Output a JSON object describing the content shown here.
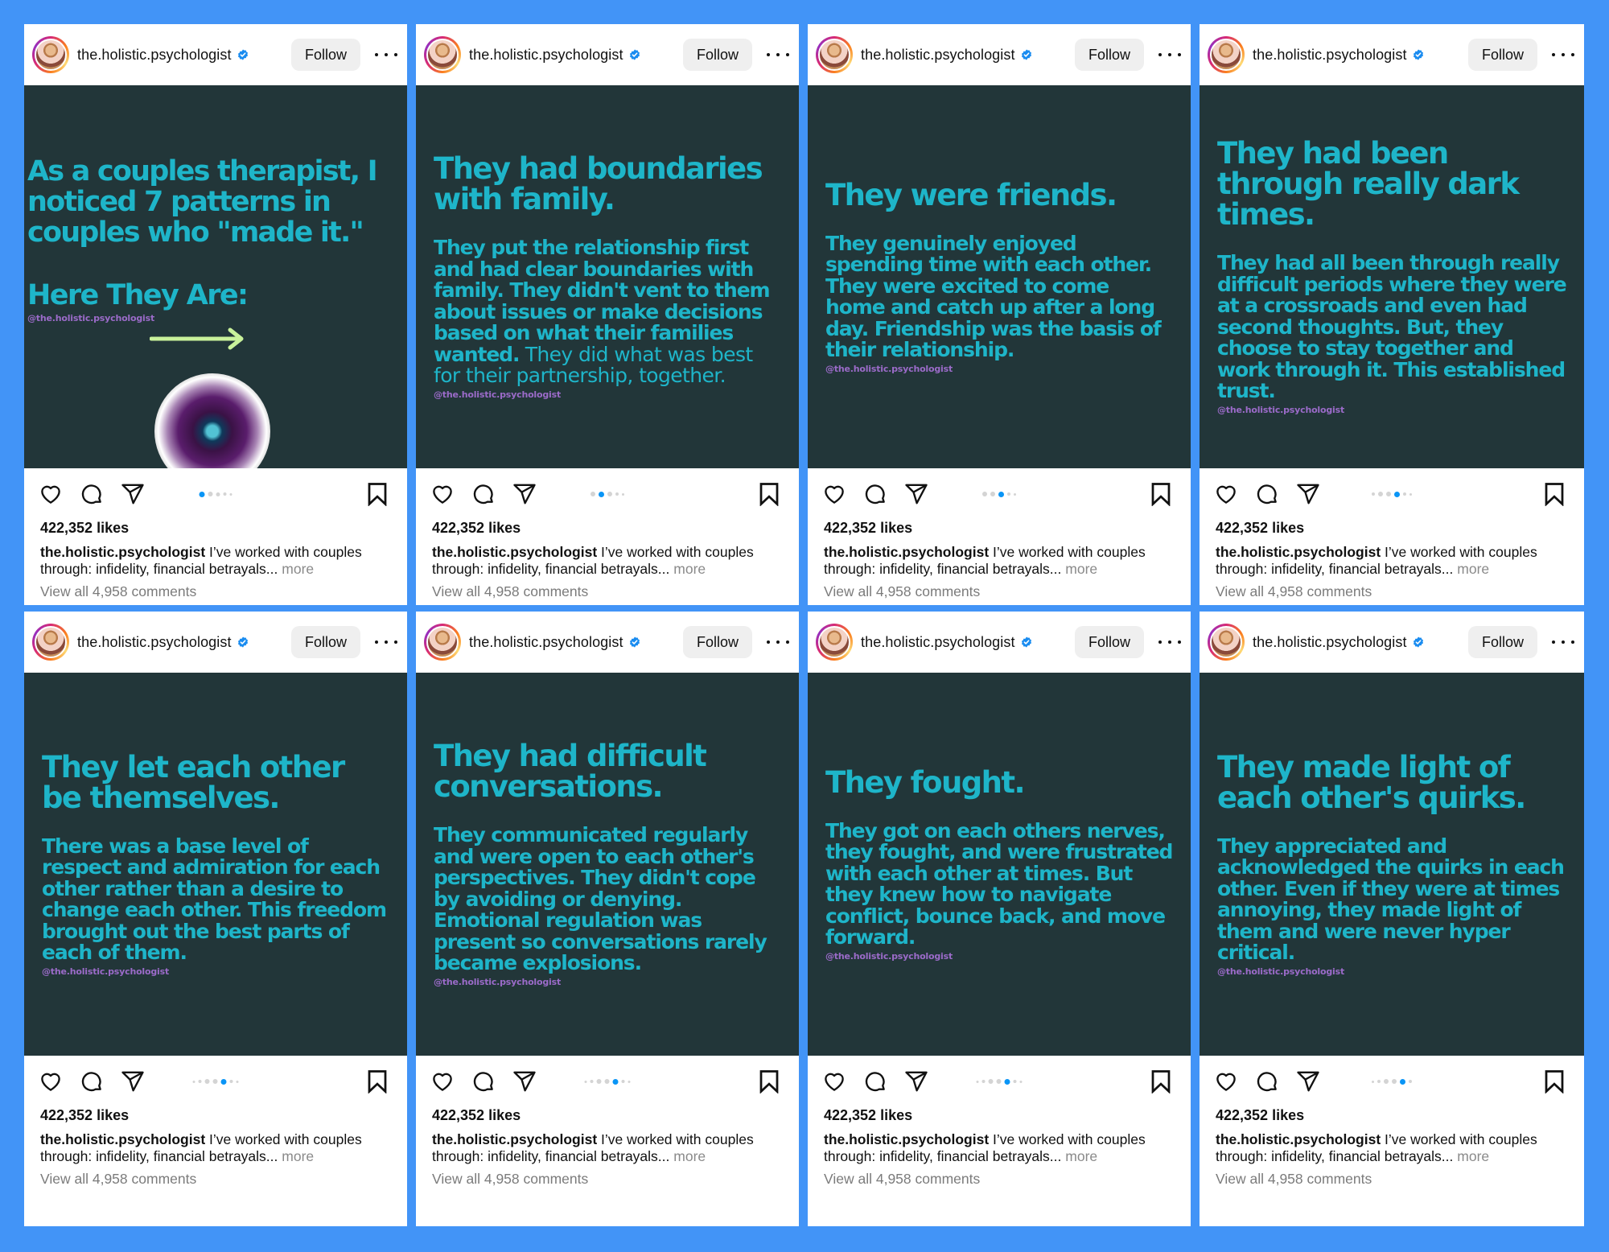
{
  "colors": {
    "background": "#4294f7",
    "slide_bg": "#223639",
    "slide_text": "#1eb5c9",
    "handle_text": "#9b6bc9",
    "active_dot": "#0a95f6",
    "verified": "#1a8cf0",
    "arrow": "#c9f29b"
  },
  "account": {
    "username": "the.holistic.psychologist",
    "verified_icon": "verified-badge-icon",
    "follow_label": "Follow",
    "more_icon": "more-options-icon"
  },
  "post_meta": {
    "likes": "422,352 likes",
    "caption_user": "the.holistic.psychologist",
    "caption_text": " I’ve worked with couples through: infidelity, financial betrayals...",
    "caption_more": " more",
    "comments_link": "View all 4,958 comments"
  },
  "icons": {
    "like": "heart-icon",
    "comment": "comment-bubble-icon",
    "share": "paper-plane-icon",
    "save": "bookmark-icon"
  },
  "posts": [
    {
      "slide_index": 1,
      "type": "intro",
      "title": "As a couples therapist, I noticed 7 patterns in couples who \"made it.\"",
      "subtitle": "Here They Are:",
      "handle": "@the.holistic.psychologist",
      "dots": [
        "active",
        "s6",
        "s5",
        "s4",
        "s3"
      ]
    },
    {
      "slide_index": 2,
      "title": "They had boundaries with family.",
      "body": "They put the relationship first and had clear boundaries with family. They didn't vent to them about issues or make decisions based on what their families wanted.",
      "body_light": " They did what was best for their partnership, together.",
      "handle": "@the.holistic.psychologist",
      "dots": [
        "s6",
        "active",
        "s6",
        "s4",
        "s3"
      ]
    },
    {
      "slide_index": 3,
      "title": "They were friends.",
      "body": "They genuinely enjoyed spending time with each other. They were excited to come home and catch up after a long day. Friendship was the basis of their relationship.",
      "body_light": "",
      "handle": "@the.holistic.psychologist",
      "dots": [
        "s6",
        "s6",
        "active",
        "s4",
        "s3"
      ]
    },
    {
      "slide_index": 4,
      "title": "They had been through really dark times.",
      "body": "They had all been through really difficult periods where they were at a crossroads and even had second thoughts. But, they choose to stay together and work through it. This established trust.",
      "body_light": "",
      "handle": "@the.holistic.psychologist",
      "dots": [
        "s4",
        "s6",
        "s6",
        "active",
        "s4",
        "s3"
      ]
    },
    {
      "slide_index": 5,
      "title": "They let each other be themselves.",
      "body": "There was a base level of respect and admiration for each other rather than a desire to change each other. This freedom brought out the best parts of each of them.",
      "body_light": "",
      "handle": "@the.holistic.psychologist",
      "dots": [
        "s3",
        "s4",
        "s6",
        "s6",
        "active",
        "s4",
        "s3"
      ]
    },
    {
      "slide_index": 6,
      "title": "They had difficult conversations.",
      "body": "They communicated regularly and were open to each other's perspectives. They didn't cope by avoiding or denying. Emotional regulation was present so conversations rarely became explosions.",
      "body_light": "",
      "handle": "@the.holistic.psychologist",
      "dots": [
        "s3",
        "s4",
        "s6",
        "s6",
        "active",
        "s4",
        "s3"
      ]
    },
    {
      "slide_index": 7,
      "title": "They fought.",
      "body": "They got on each others nerves, they fought, and were frustrated with each other at times. But they knew how to navigate conflict, bounce back, and move forward.",
      "body_light": "",
      "handle": "@the.holistic.psychologist",
      "dots": [
        "s3",
        "s4",
        "s6",
        "s6",
        "active",
        "s4",
        "s3"
      ]
    },
    {
      "slide_index": 8,
      "title": "They made light of each other's quirks.",
      "body": "They appreciated and acknowledged the quirks in each other. Even if they were at times annoying, they made light of them and were never hyper critical.",
      "body_light": "",
      "handle": "@the.holistic.psychologist",
      "dots": [
        "s3",
        "s4",
        "s6",
        "s6",
        "active",
        "s4"
      ]
    }
  ]
}
